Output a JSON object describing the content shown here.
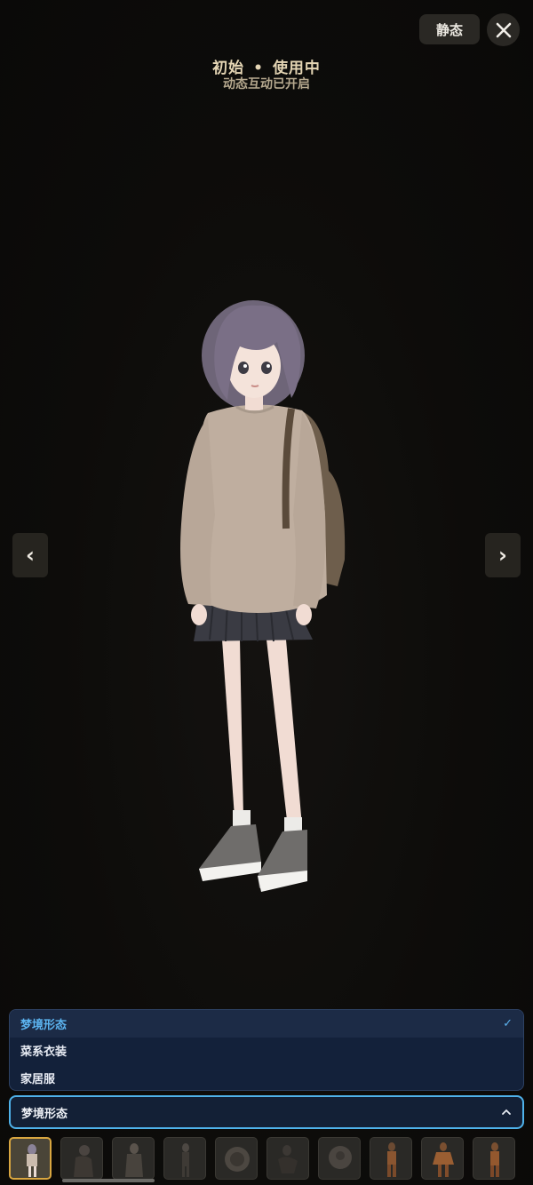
{
  "header": {
    "static_toggle_label": "静态",
    "status_title_left": "初始",
    "status_separator": "•",
    "status_title_right": "使用中",
    "status_subtitle": "动态互动已开启"
  },
  "nav": {
    "prev_glyph": "‹",
    "next_glyph": "›"
  },
  "outfit_category": {
    "options": [
      {
        "label": "梦境形态",
        "selected": true
      },
      {
        "label": "菜系衣装",
        "selected": false
      },
      {
        "label": "家居服",
        "selected": false
      }
    ],
    "selected_label": "梦境形态",
    "check_glyph": "✓",
    "collapse_glyph": "^"
  },
  "thumbnails": {
    "count": 10,
    "active_index": 0
  },
  "colors": {
    "accent_blue": "#4fb2ea",
    "accent_gold": "#d9a640",
    "title_gold": "#e4d5b4"
  },
  "icons": {
    "close": "close-icon",
    "prev": "chevron-left-icon",
    "next": "chevron-right-icon",
    "check": "check-icon",
    "collapse": "chevron-up-icon"
  }
}
